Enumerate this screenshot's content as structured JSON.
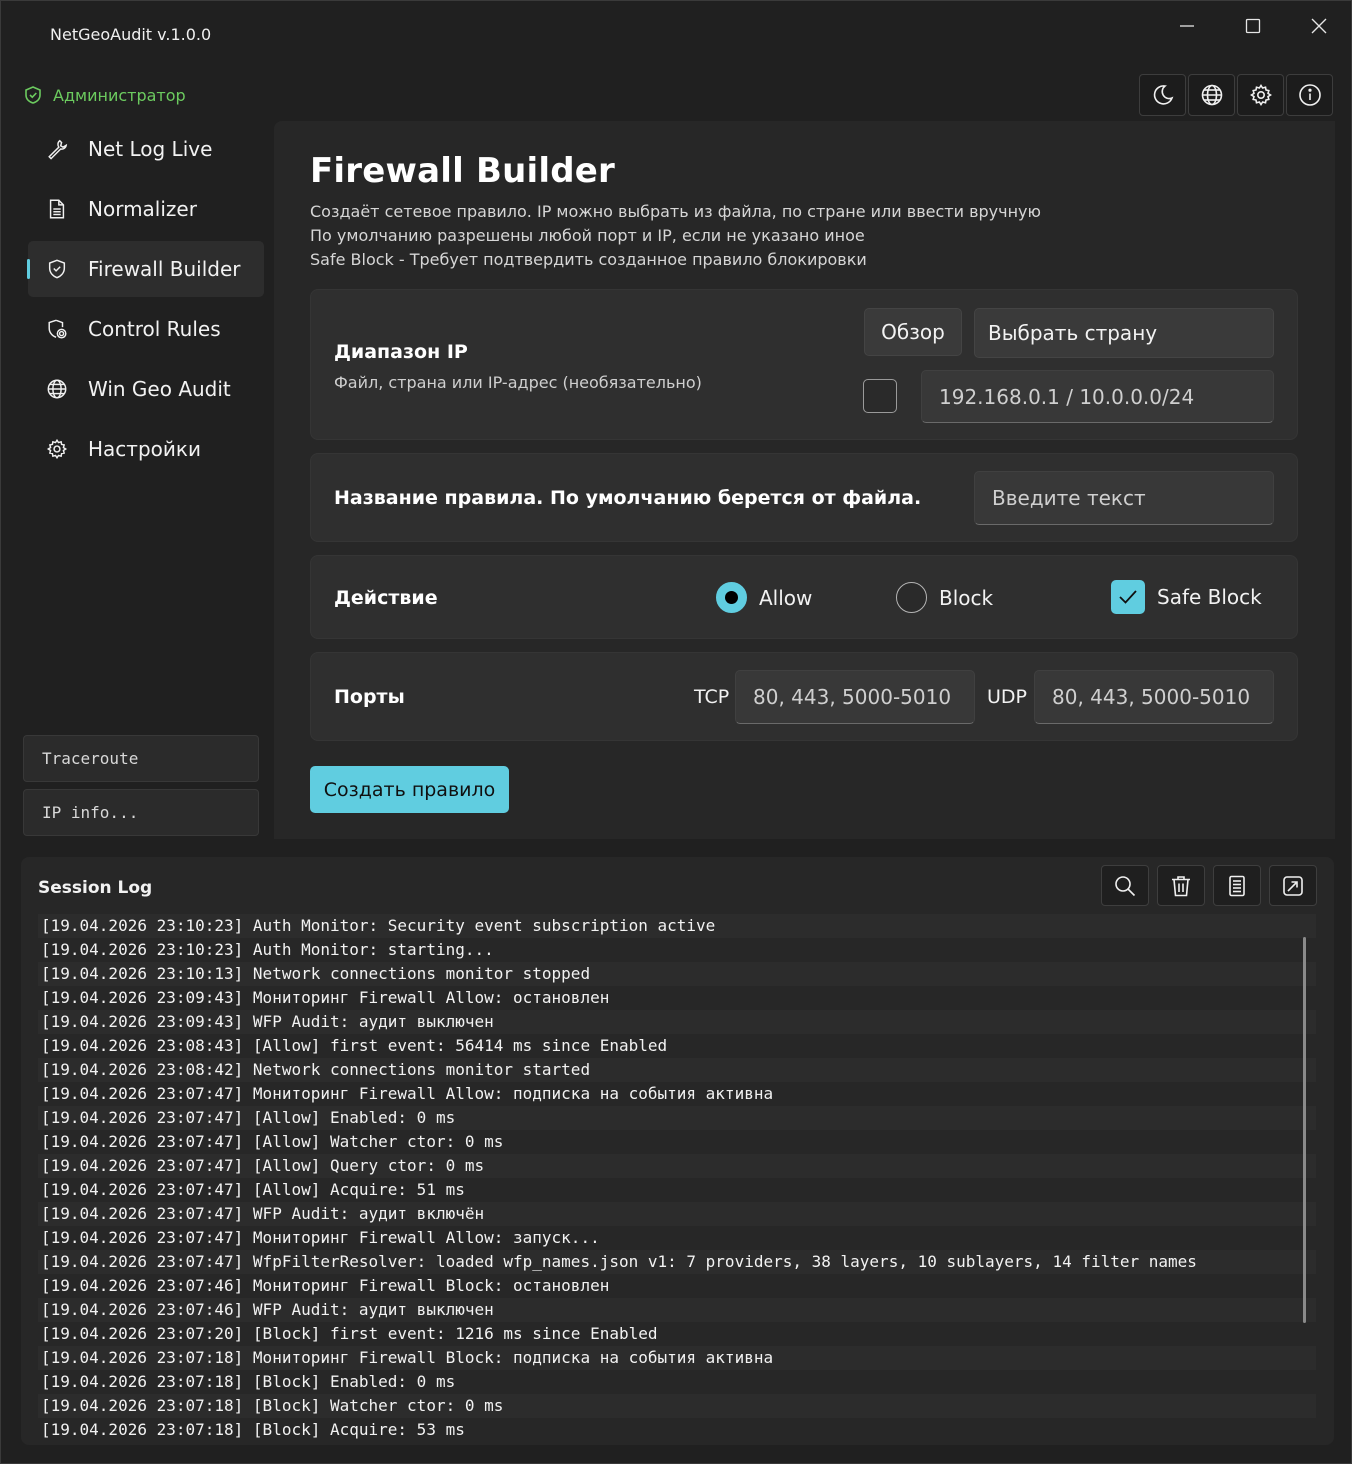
{
  "window": {
    "title": "NetGeoAudit v.1.0.0",
    "controls": [
      "minimize-icon",
      "maximize-icon",
      "close-icon"
    ]
  },
  "role": {
    "label": "Администратор",
    "icon": "shield-check-icon",
    "color": "#6ccb5f"
  },
  "toolbar": {
    "icons": [
      "moon-icon",
      "globe-icon",
      "gear-icon",
      "info-icon"
    ]
  },
  "sidebar": {
    "items": [
      {
        "label": "Net Log Live",
        "icon": "wrench-icon"
      },
      {
        "label": "Normalizer",
        "icon": "document-icon"
      },
      {
        "label": "Firewall Builder",
        "icon": "shield-icon",
        "active": true
      },
      {
        "label": "Control Rules",
        "icon": "shield-gear-icon"
      },
      {
        "label": "Win Geo Audit",
        "icon": "globe-icon"
      },
      {
        "label": "Настройки",
        "icon": "gear-icon"
      }
    ],
    "traceroute_label": "Traceroute",
    "ipinfo_label": "IP info..."
  },
  "page": {
    "title": "Firewall Builder",
    "desc1": "Создаёт сетевое правило. IP можно выбрать из файла, по стране или ввести вручную",
    "desc2": "По умолчанию разрешены любой порт и IP, если не указано иное",
    "desc3": "Safe Block - Требует подтвердить созданное правило блокировки"
  },
  "ip_card": {
    "label": "Диапазон IP",
    "sub": "Файл, страна или IP-адрес (необязательно)",
    "browse_label": "Обзор",
    "country_label": "Выбрать страну",
    "ip_placeholder": "192.168.0.1 / 10.0.0.0/24",
    "checkbox_checked": false
  },
  "name_card": {
    "label": "Название правила. По умолчанию берется от файла.",
    "placeholder": "Введите текст"
  },
  "action_card": {
    "label": "Действие",
    "allow_label": "Allow",
    "block_label": "Block",
    "safe_block_label": "Safe Block",
    "selected": "Allow",
    "safe_block_checked": true
  },
  "ports_card": {
    "label": "Порты",
    "tcp_label": "TCP",
    "udp_label": "UDP",
    "tcp_placeholder": "80, 443, 5000-5010",
    "udp_placeholder": "80, 443, 5000-5010"
  },
  "create_label": "Создать правило",
  "accent": "#60cde0",
  "log": {
    "title": "Session Log",
    "tools": [
      "search-icon",
      "trash-icon",
      "list-icon",
      "open-external-icon"
    ],
    "lines": [
      "[19.04.2026 23:10:23] Auth Monitor: Security event subscription active",
      "[19.04.2026 23:10:23] Auth Monitor: starting...",
      "[19.04.2026 23:10:13] Network connections monitor stopped",
      "[19.04.2026 23:09:43] Мониторинг Firewall Allow: остановлен",
      "[19.04.2026 23:09:43] WFP Audit: аудит выключен",
      "[19.04.2026 23:08:43] [Allow] first event: 56414 ms since Enabled",
      "[19.04.2026 23:08:42] Network connections monitor started",
      "[19.04.2026 23:07:47] Мониторинг Firewall Allow: подписка на события активна",
      "[19.04.2026 23:07:47] [Allow] Enabled: 0 ms",
      "[19.04.2026 23:07:47] [Allow] Watcher ctor: 0 ms",
      "[19.04.2026 23:07:47] [Allow] Query ctor: 0 ms",
      "[19.04.2026 23:07:47] [Allow] Acquire: 51 ms",
      "[19.04.2026 23:07:47] WFP Audit: аудит включён",
      "[19.04.2026 23:07:47] Мониторинг Firewall Allow: запуск...",
      "[19.04.2026 23:07:47] WfpFilterResolver: loaded wfp_names.json v1: 7 providers, 38 layers, 10 sublayers, 14 filter names",
      "[19.04.2026 23:07:46] Мониторинг Firewall Block: остановлен",
      "[19.04.2026 23:07:46] WFP Audit: аудит выключен",
      "[19.04.2026 23:07:20] [Block] first event: 1216 ms since Enabled",
      "[19.04.2026 23:07:18] Мониторинг Firewall Block: подписка на события активна",
      "[19.04.2026 23:07:18] [Block] Enabled: 0 ms",
      "[19.04.2026 23:07:18] [Block] Watcher ctor: 0 ms",
      "[19.04.2026 23:07:18] [Block] Acquire: 53 ms"
    ]
  }
}
